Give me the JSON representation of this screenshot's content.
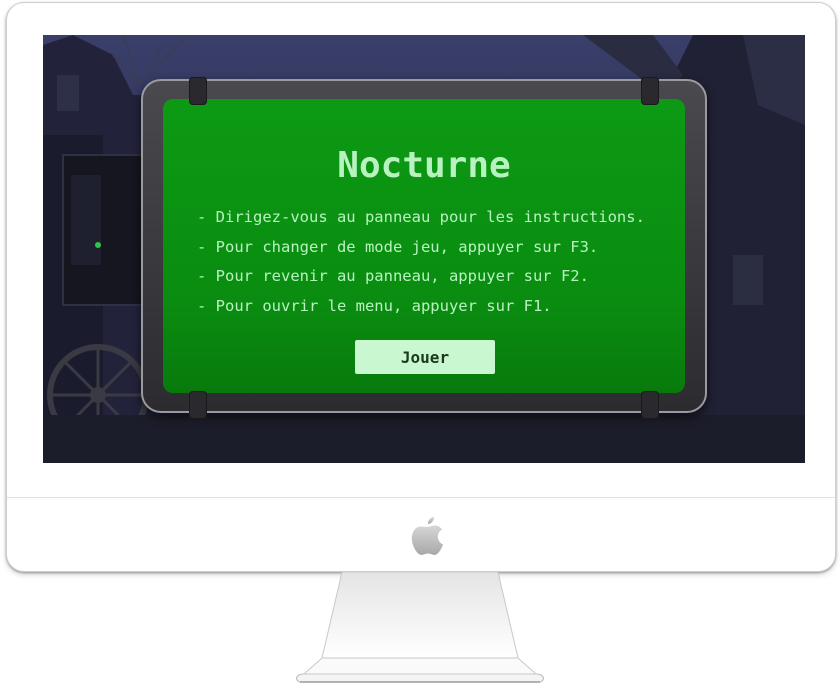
{
  "game": {
    "title": "Nocturne",
    "instructions": [
      "- Dirigez-vous au panneau pour les instructions.",
      "- Pour changer de mode jeu, appuyer sur F3.",
      "- Pour revenir au panneau, appuyer sur F2.",
      "- Pour ouvrir le menu, appuyer sur F1."
    ],
    "play_label": "Jouer"
  },
  "colors": {
    "sign_green": "#0a8c10",
    "text_green": "#b8f2c0",
    "button_bg": "#c9f7cf",
    "night_sky": "#2a2e52"
  },
  "icons": {
    "device_logo": "apple-logo-icon"
  }
}
